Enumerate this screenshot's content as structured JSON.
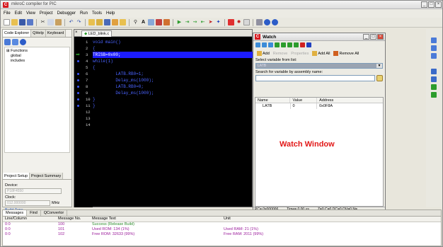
{
  "app": {
    "title": "mikroC compiler for PIC",
    "icon": "mikroc-logo-icon",
    "controls": [
      "_",
      "□",
      "×"
    ]
  },
  "menu": [
    "File",
    "Edit",
    "View",
    "Project",
    "Debugger",
    "Run",
    "Tools",
    "Help"
  ],
  "left_panel": {
    "tabs": [
      "Code Explorer",
      "QHelp",
      "Keyboard"
    ],
    "tree": [
      {
        "label": "Functions",
        "expander": "⊞",
        "level": 0
      },
      {
        "label": "global",
        "level": 1
      },
      {
        "label": "includes",
        "level": 1
      }
    ],
    "setup_tabs": [
      "Project Setup",
      "Project Summary"
    ],
    "device_label": "Device:",
    "device_value": "P18F4550",
    "clock_label": "Clock:",
    "clock_value": "012.000000",
    "clock_unit": "MHz",
    "build_type_link": "Build Type"
  },
  "editor": {
    "tab_label": "LED_blink.c",
    "lines": [
      {
        "no": "1",
        "text": "void main()",
        "highlight": false,
        "bullet": false
      },
      {
        "no": "2",
        "text": "{",
        "highlight": false,
        "bullet": false
      },
      {
        "no": "3",
        "text": "TRISB=0x00;",
        "highlight": true,
        "bullet": false
      },
      {
        "no": "4",
        "text": "while(1)",
        "highlight": false,
        "bullet": true
      },
      {
        "no": "5",
        "text": "{",
        "highlight": false,
        "bullet": false
      },
      {
        "no": "6",
        "text": "         LATB.RB0=1;",
        "highlight": false,
        "bullet": true
      },
      {
        "no": "7",
        "text": "         Delay_ms(1000);",
        "highlight": false,
        "bullet": true
      },
      {
        "no": "8",
        "text": "         LATB.RB0=0;",
        "highlight": false,
        "bullet": true
      },
      {
        "no": "9",
        "text": "         Delay_ms(1000);",
        "highlight": false,
        "bullet": true
      },
      {
        "no": "10",
        "text": "}",
        "highlight": false,
        "bullet": true
      },
      {
        "no": "11",
        "text": "}",
        "highlight": false,
        "bullet": true
      },
      {
        "no": "12",
        "text": "",
        "highlight": false,
        "bullet": false
      },
      {
        "no": "13",
        "text": "",
        "highlight": false,
        "bullet": false
      },
      {
        "no": "14",
        "text": "",
        "highlight": false,
        "bullet": false
      }
    ]
  },
  "watch": {
    "title": "Watch",
    "actions": {
      "add": "Add",
      "remove": "Remove",
      "properties": "Properties",
      "add_all": "Add All",
      "remove_all": "Remove All"
    },
    "select_label": "Select variable from list:",
    "select_value": "LATB",
    "search_label": "Search for variable by assembly name:",
    "search_value": "",
    "columns": [
      "Name",
      "Value",
      "Address"
    ],
    "rows": [
      {
        "name": "LATB",
        "value": "0",
        "address": "0x0F8A"
      }
    ],
    "caption": "Watch Window",
    "status": {
      "pc": "PC= 0x000006",
      "time": "Time= 0.00 us",
      "flags": "Z=0 C=0 DC=0 OV=0 N="
    }
  },
  "messages": {
    "tabs": [
      "Messages",
      "Find",
      "QConvertor"
    ],
    "columns": [
      "Line/Column",
      "Message No.",
      "Message Text",
      "Unit"
    ],
    "rows": [
      {
        "line": "0:0",
        "no": "100",
        "text": "Success (Release Build)",
        "unit": ""
      },
      {
        "line": "0:0",
        "no": "101",
        "text": "Used ROM: 134 (1%)",
        "unit": "Used RAM: 21 (1%)"
      },
      {
        "line": "0:0",
        "no": "102",
        "text": "Free ROM: 32633 (99%)",
        "unit": "Free RAM: 2011 (99%)"
      }
    ]
  },
  "colors": {
    "editor_bg": "#000000",
    "code_text": "#4a63ff",
    "highlight": "#1c1cff",
    "watch_caption": "#e21717"
  }
}
